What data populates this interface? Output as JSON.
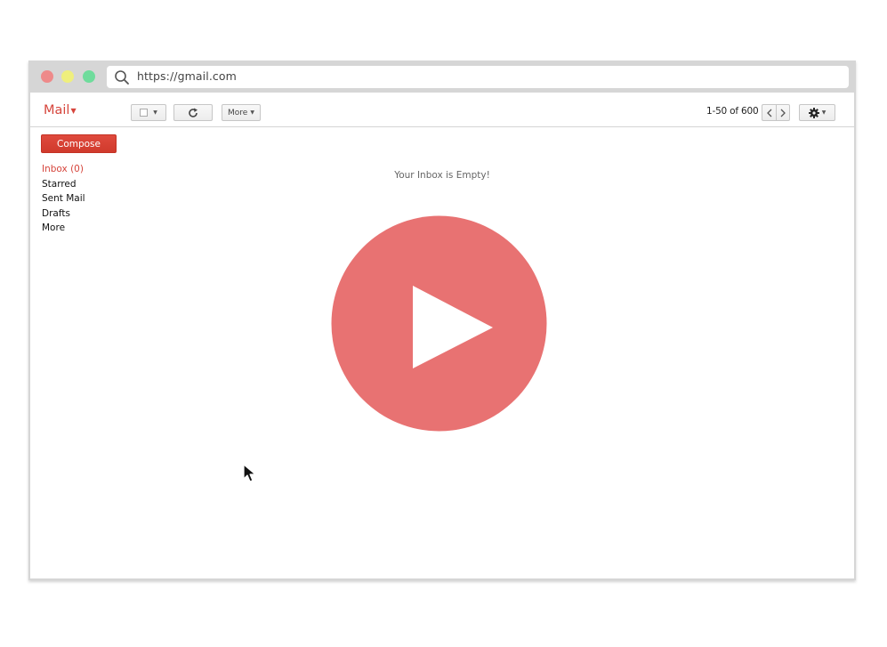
{
  "browser": {
    "url": "https://gmail.com",
    "traffic_lights": [
      "#ee8a8a",
      "#efef7d",
      "#6fdc9c"
    ]
  },
  "toolbar": {
    "brand_label": "Mail",
    "more_label": "More",
    "pagination": "1-50 of 600"
  },
  "sidebar": {
    "compose_label": "Compose",
    "items": [
      {
        "label": "Inbox (0)",
        "active": true
      },
      {
        "label": "Starred"
      },
      {
        "label": "Sent Mail"
      },
      {
        "label": "Drafts"
      },
      {
        "label": "More"
      }
    ]
  },
  "main": {
    "empty_message": "Your Inbox is Empty!",
    "player_icon": "play-icon"
  },
  "colors": {
    "accent": "#d6453c",
    "player": "#e87272"
  }
}
